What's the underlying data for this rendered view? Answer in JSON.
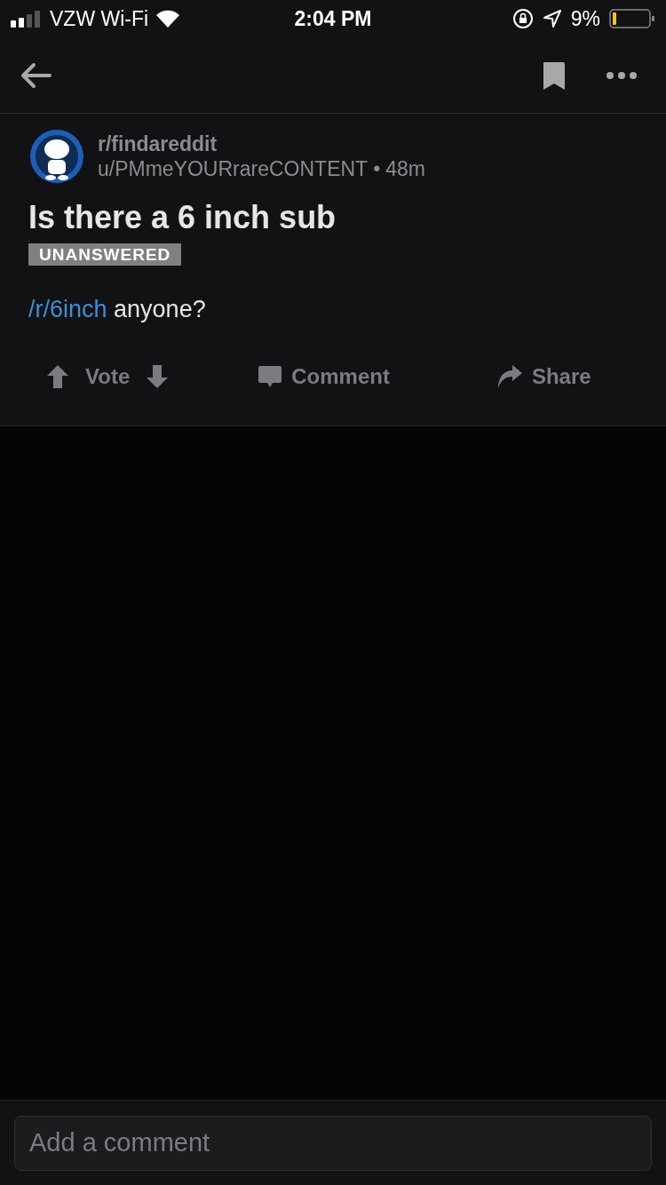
{
  "status_bar": {
    "carrier": "VZW Wi-Fi",
    "time": "2:04 PM",
    "battery_percent": "9%"
  },
  "post": {
    "subreddit": "r/findareddit",
    "author": "u/PMmeYOURrareCONTENT",
    "separator": "•",
    "age": "48m",
    "title": "Is there a 6 inch sub",
    "flair": "UNANSWERED",
    "body_link": "/r/6inch",
    "body_text": "anyone?"
  },
  "actions": [
    {
      "kind": "vote",
      "label": "Vote"
    },
    {
      "kind": "comment",
      "label": "Comment"
    },
    {
      "kind": "share",
      "label": "Share"
    }
  ],
  "comment_field": {
    "placeholder": "Add a comment"
  }
}
